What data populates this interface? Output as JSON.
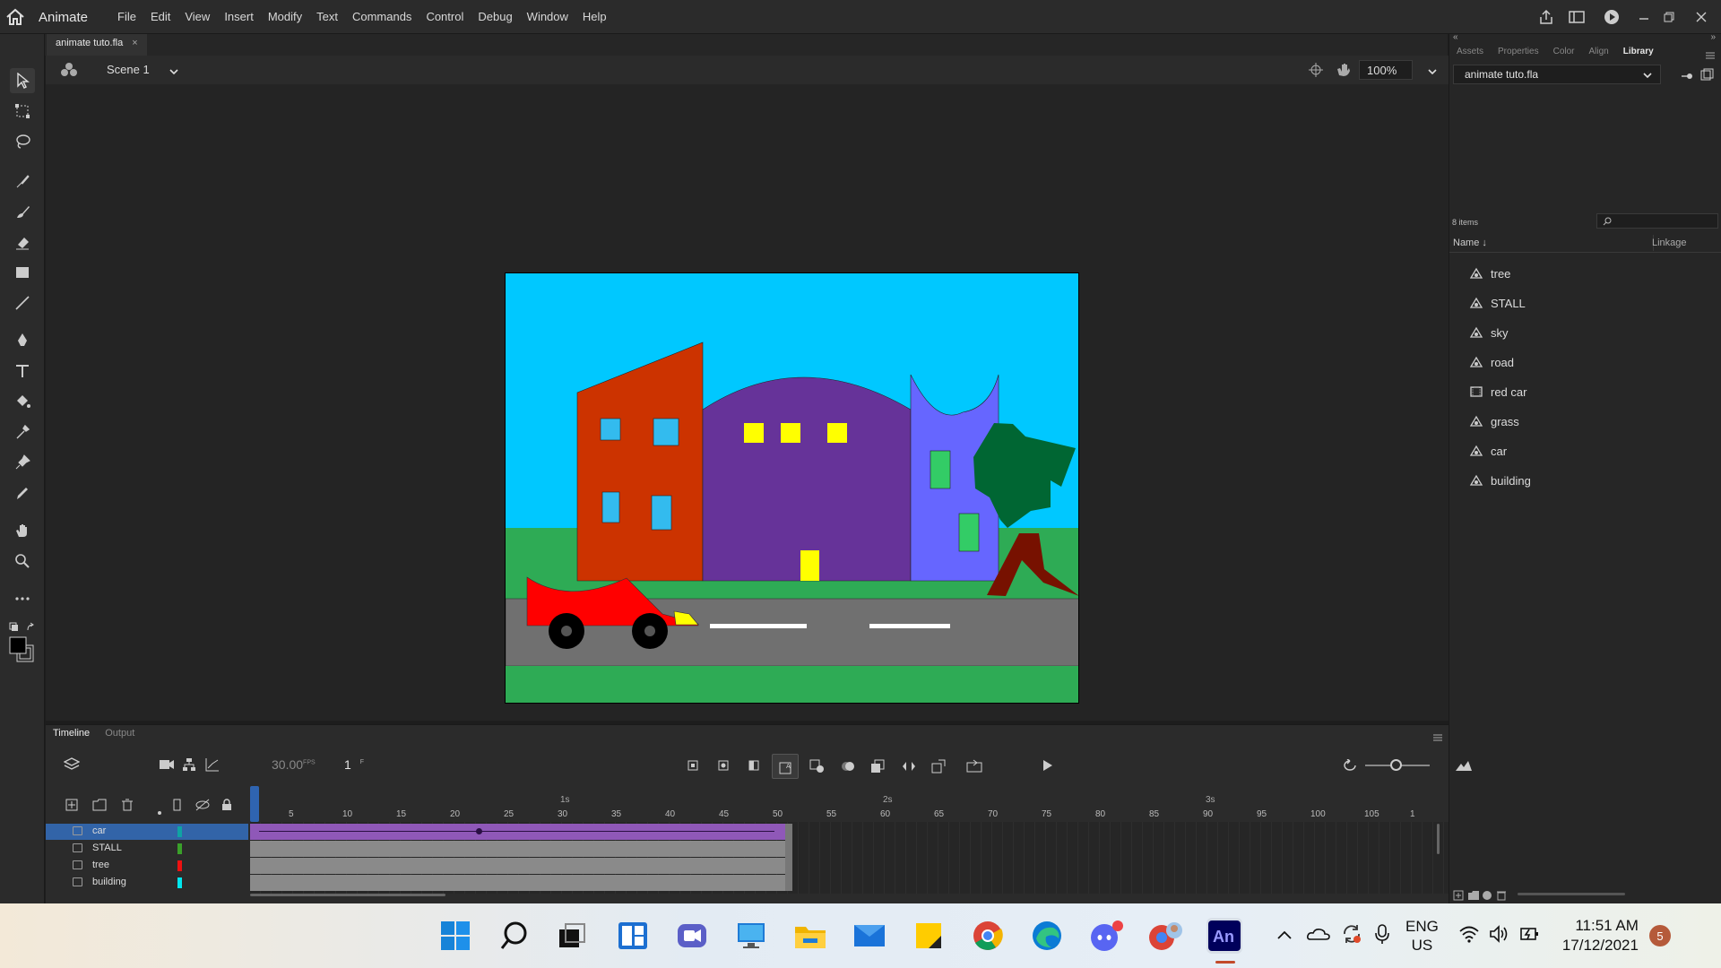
{
  "menubar": {
    "app_name": "Animate",
    "menus": [
      "File",
      "Edit",
      "View",
      "Insert",
      "Modify",
      "Text",
      "Commands",
      "Control",
      "Debug",
      "Window",
      "Help"
    ]
  },
  "document": {
    "tab_title": "animate tuto.fla",
    "close": "×"
  },
  "scene": {
    "name": "Scene 1",
    "zoom": "100%"
  },
  "right_panel": {
    "tabs": [
      "Assets",
      "Properties",
      "Color",
      "Align",
      "Library"
    ],
    "active_tab": "Library",
    "library_select": "animate tuto.fla",
    "item_count": "8 items",
    "col_name": "Name",
    "col_linkage": "Linkage",
    "items": [
      "tree",
      "STALL",
      "sky",
      "road",
      "red car",
      "grass",
      "car",
      "building"
    ]
  },
  "timeline": {
    "tabs": [
      "Timeline",
      "Output"
    ],
    "fps": "30.00",
    "fps_unit": "FPS",
    "current_frame": "1",
    "frame_unit": "F",
    "seconds": [
      "1s",
      "2s",
      "3s"
    ],
    "frame_numbers": [
      "5",
      "10",
      "15",
      "20",
      "25",
      "30",
      "35",
      "40",
      "45",
      "50",
      "55",
      "60",
      "65",
      "70",
      "75",
      "80",
      "85",
      "90",
      "95",
      "100",
      "105",
      "1"
    ],
    "layers": [
      {
        "name": "car",
        "color": "#10a3a3"
      },
      {
        "name": "STALL",
        "color": "#3aa02a"
      },
      {
        "name": "tree",
        "color": "#ee1111"
      },
      {
        "name": "building",
        "color": "#00e6ee"
      }
    ]
  },
  "taskbar": {
    "lang1": "ENG",
    "lang2": "US",
    "time": "11:51 AM",
    "date": "17/12/2021",
    "notif": "5"
  }
}
